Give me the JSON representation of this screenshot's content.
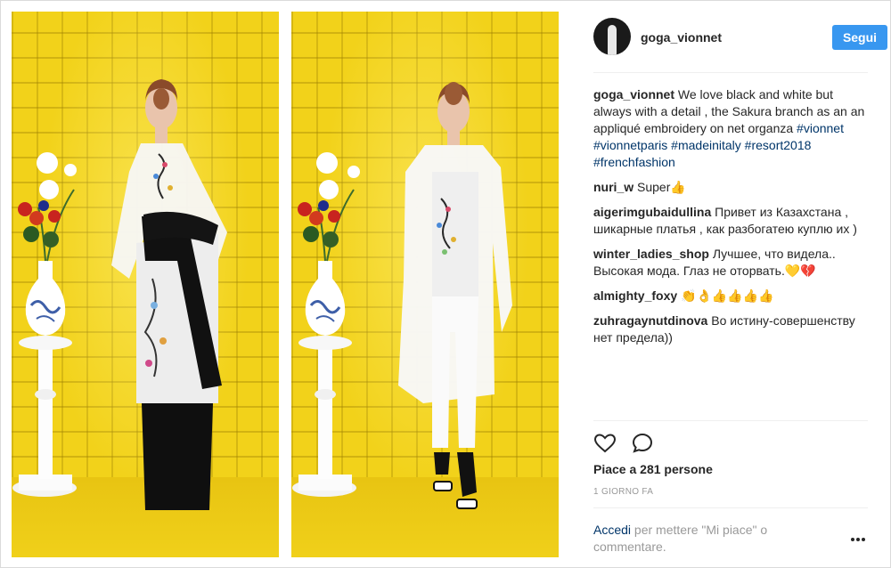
{
  "post": {
    "username": "goga_vionnet",
    "follow_label": "Segui",
    "caption": {
      "user": "goga_vionnet",
      "text": "We love black and white but always with a detail , the Sakura branch as an an appliqué embroidery on net organza",
      "hashtags": [
        "#vionnet",
        "#vionnetparis",
        "#madeinitaly",
        "#resort2018",
        "#frenchfashion"
      ]
    },
    "comments": [
      {
        "user": "nuri_w",
        "text": "Super👍"
      },
      {
        "user": "aigerimgubaidullina",
        "text": "Привет из Казахстана , шикарные платья , как разбогатею куплю их )"
      },
      {
        "user": "winter_ladies_shop",
        "text": "Лучшее, что видела.. Высокая мода. Глаз не оторвать.💛💔"
      },
      {
        "user": "almighty_foxy",
        "text": "👏👌👍👍👍👍"
      },
      {
        "user": "zuhragaynutdinova",
        "text": "Во истину-совершенству нет предела))"
      }
    ],
    "likes": "Piace a 281 persone",
    "timestamp": "1 GIORNO FA",
    "login_prompt": {
      "link": "Accedi",
      "text": "per mettere \"Mi piace\" o commentare."
    }
  },
  "icons": {
    "like": "heart-icon",
    "comment": "comment-bubble-icon",
    "more": "more-options-icon"
  },
  "colors": {
    "follow_button": "#3897f0",
    "link": "#003569",
    "muted": "#999999",
    "background_yellow": "#f2d21a"
  }
}
